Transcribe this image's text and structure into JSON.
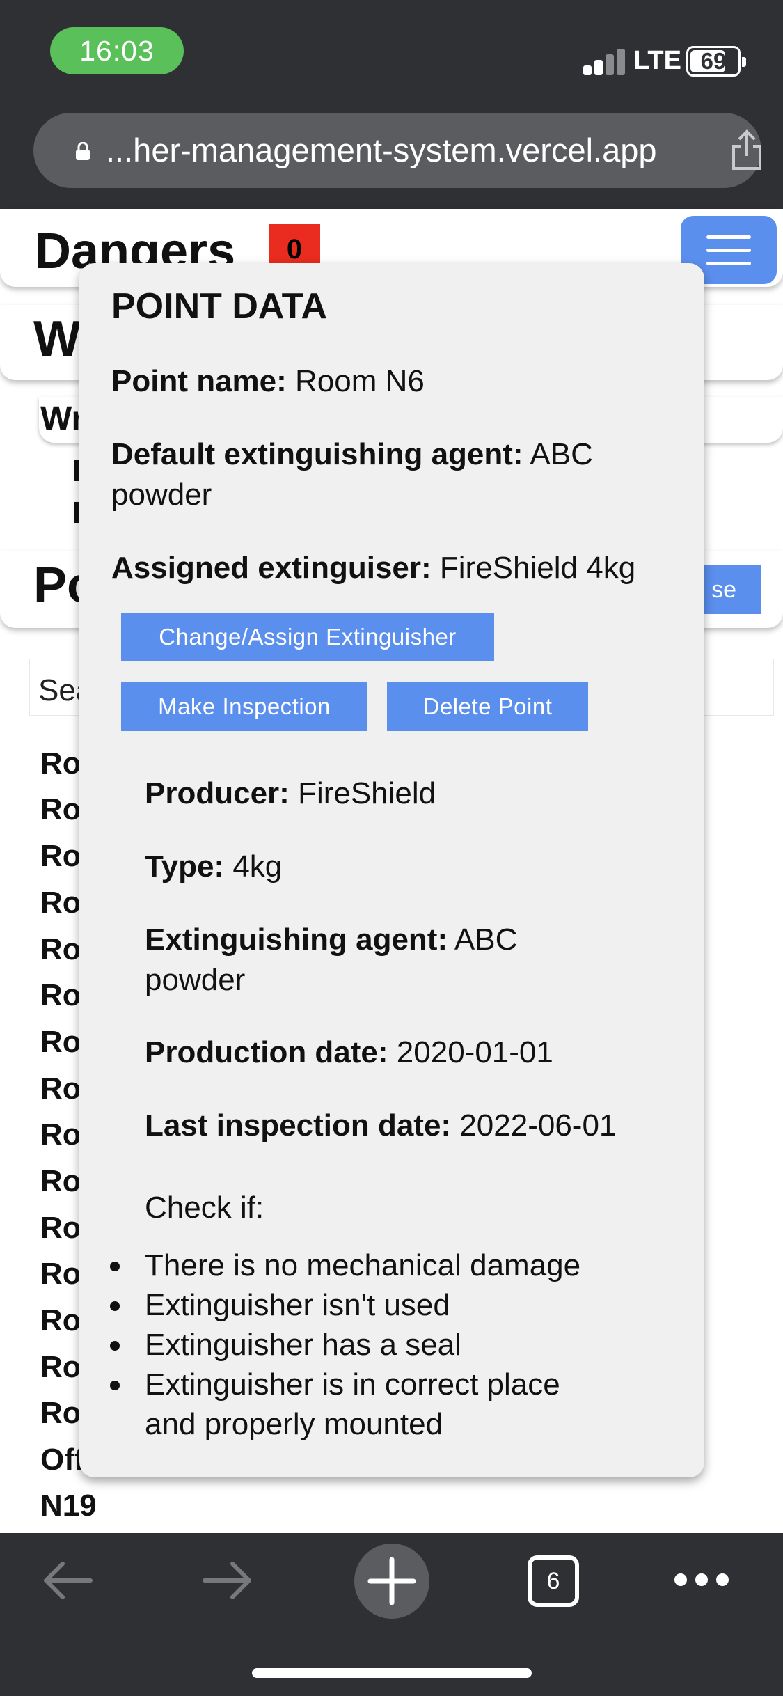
{
  "status": {
    "time": "16:03",
    "network": "LTE",
    "battery": "69",
    "battery_level": 0.69
  },
  "browser": {
    "url": "...her-management-system.vercel.app",
    "tabs_count": "6"
  },
  "page": {
    "dangers_title": "Dangers",
    "dangers_count": "0",
    "section_w": "W",
    "section_wr": "Wr",
    "section_po": "Po",
    "right_button_partial": "se",
    "search_placeholder": "Sea",
    "list_items": [
      "Ro",
      "Ro",
      "Ro",
      "Ro",
      "Ro",
      "Ro",
      "Ro",
      "Ro",
      "Ro",
      "Ro",
      "Ro",
      "Ro",
      "Ro",
      "Ro",
      "Ro",
      "Off",
      "N19"
    ]
  },
  "modal": {
    "title": "POINT DATA",
    "point_name_label": "Point name:",
    "point_name": "Room N6",
    "default_agent_label": "Default extinguishing agent:",
    "default_agent": "ABC",
    "default_agent_cont": "powder",
    "assigned_label": "Assigned extinguiser:",
    "assigned": "FireShield 4kg",
    "buttons": {
      "change_assign": "Change/Assign Extinguisher",
      "make_inspection": "Make Inspection",
      "delete_point": "Delete Point"
    },
    "producer_label": "Producer:",
    "producer": "FireShield",
    "type_label": "Type:",
    "type": "4kg",
    "agent_label": "Extinguishing agent:",
    "agent": "ABC",
    "agent_cont": "powder",
    "production_label": "Production date:",
    "production_date": "2020-01-01",
    "last_inspection_label": "Last inspection date:",
    "last_inspection_date": "2022-06-01",
    "check_if": "Check if:",
    "checklist": [
      "There is no mechanical damage",
      "Extinguisher isn't used",
      "Extinguisher has a seal",
      "Extinguisher is in correct place",
      "and properly mounted"
    ]
  },
  "icons": {
    "back": "arrow-left-icon",
    "forward": "arrow-right-icon",
    "new_tab": "plus-icon",
    "more": "more-icon",
    "share": "share-icon",
    "lock": "lock-icon"
  }
}
